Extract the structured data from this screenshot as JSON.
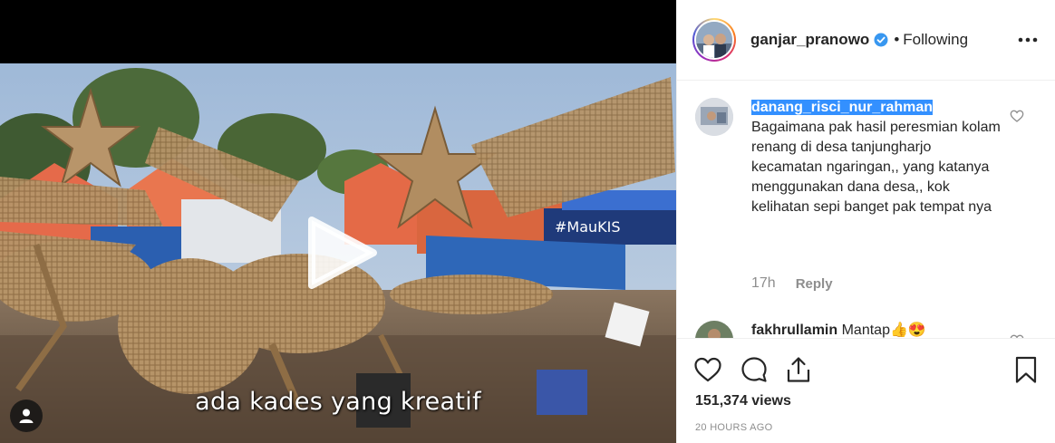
{
  "video": {
    "subtitle": "ada kades yang kreatif",
    "banner_text": "#MauKIS"
  },
  "header": {
    "username": "ganjar_pranowo",
    "separator": "•",
    "follow_status": "Following"
  },
  "comments": [
    {
      "username": "danang_risci_nur_rahman",
      "text": "Bagaimana pak hasil peresmian kolam renang di desa tanjungharjo kecamatan ngaringan,, yang katanya menggunakan dana desa,, kok kelihatan sepi banget pak tempat nya",
      "time": "17h",
      "reply_label": "Reply"
    },
    {
      "username": "fakhrullamin",
      "text": "Mantap👍😍"
    }
  ],
  "stats": {
    "views": "151,374 views",
    "time_ago": "20 HOURS AGO"
  },
  "colors": {
    "verified": "#3897f0",
    "selection": "#3390ff",
    "muted": "#8e8e8e"
  },
  "icons": [
    "play-icon",
    "user-tag-icon",
    "verified-icon",
    "more-options-icon",
    "heart-icon",
    "comment-icon",
    "share-icon",
    "bookmark-icon"
  ]
}
